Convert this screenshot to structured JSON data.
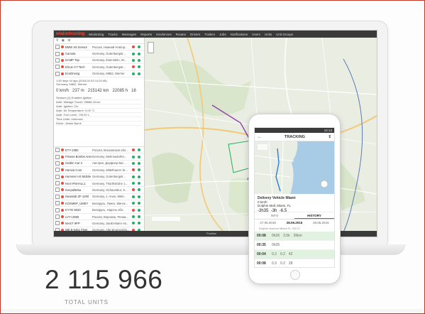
{
  "app": {
    "logo": "wialonhosting",
    "nav": [
      "Monitoring",
      "Tracks",
      "Messages",
      "Reports",
      "Geofences",
      "Routes",
      "Drivers",
      "Trailers",
      "Jobs",
      "Notifications",
      "Users",
      "Units",
      "Unit Groups"
    ]
  },
  "units": [
    {
      "name": "BMW X6 Sensor",
      "location": "Россия, Нижний Новгор..."
    },
    {
      "name": "Camola",
      "location": "Germany, Gutenbergstr..."
    },
    {
      "name": "DAMP Top",
      "location": "Germany, Eisenstein, W..."
    },
    {
      "name": "Ehcar CT-Tech",
      "location": "Germany, Gutenbergstr..."
    },
    {
      "name": "EcoDriving",
      "location": "Germany, M852, Werner"
    }
  ],
  "detail": {
    "time": "1:50 days 44 ago (2018-02-03 14:20:45)",
    "address": "Germany, M852, Werner",
    "speed": "0 km/h",
    "altitude": "237 m",
    "mileage": "215142 km",
    "hours": "22085 h",
    "count": "16",
    "lines": [
      "Sensors (4) Enabled Ignition",
      "Addr: Mileage Tracer: 95688.18 km",
      "Addr: Ignition: On",
      "Addr: Air Temperature: 0.00 °C",
      "Addr: Fuel Level: 739.00 L",
      "Time Units: Unknown",
      "Driver: Jessie Byrne"
    ]
  },
  "units2": [
    {
      "name": "ETY-1980",
      "location": "Россия, Московская обл..."
    },
    {
      "name": "Fitness Bombs Arena",
      "location": "Germany, Mehrowdorfer..."
    },
    {
      "name": "Garbin Car 2",
      "location": "Австрия, Дорфнер Ваг..."
    },
    {
      "name": "Hamza Core",
      "location": "Germany, Mittelhaerer St..."
    },
    {
      "name": "Hummer H3 Mobile",
      "location": "Germany, Gutenbergstr..."
    },
    {
      "name": "Ivtor IPSHALL1",
      "location": "Germany, Tharthstrahe 1..."
    },
    {
      "name": "Keepaliteba",
      "location": "Germany, Ochaumbur, S..."
    },
    {
      "name": "Nowstab ZF-1200",
      "location": "Germany, J. Anon, Mitel..."
    },
    {
      "name": "KOSMEP_UMEY",
      "location": "Беларусь, Пинск, Минск..."
    },
    {
      "name": "KYYE 6020",
      "location": "Беларусь, Нарочь обл..."
    },
    {
      "name": "LVYI 2860",
      "location": "Россия, Воронеж, Ренкж..."
    },
    {
      "name": "MAST 9PP",
      "location": "Germany, Sankt-Marin-As..."
    },
    {
      "name": "MB B-6451 Fleet",
      "location": "Germany, Alte Brunnenbst..."
    },
    {
      "name": "Peugeot Partner IBMB",
      "location": "Беларусь, Минск, Минск..."
    },
    {
      "name": "Lucas Adagne",
      "location": "Germany, Parkstrasse, M..."
    }
  ],
  "status_text": "Position",
  "phone": {
    "status_time": "12:13",
    "title": "TRACKING",
    "vehicle_name": "Delivery Vehicle Miami",
    "vehicle_speed": "0 km/h",
    "vehicle_address": "Dolphin Mall, Miami, FL",
    "vehicle_values": [
      "-3h35",
      "-3h",
      "-6.5"
    ],
    "tabs": [
      "INFO",
      "HISTORY"
    ],
    "dates": [
      "27.06.2015",
      "28.06.2015",
      "29.06.2015"
    ],
    "note": "Dolphin Avenue Miami FL 33172",
    "rows": [
      {
        "time": "00:08",
        "values": [
          "0h26",
          "3.5k",
          "26km"
        ]
      },
      {
        "time": "00:35",
        "values": [
          "0h35",
          ""
        ]
      },
      {
        "time": "00:04",
        "values": [
          "0.2",
          "0.2",
          "42"
        ]
      },
      {
        "time": "00:08",
        "values": [
          "0.3",
          "0.2",
          "28"
        ]
      }
    ]
  },
  "stats": {
    "total_number": "2 115 966",
    "total_label": "TOTAL UNITS"
  }
}
